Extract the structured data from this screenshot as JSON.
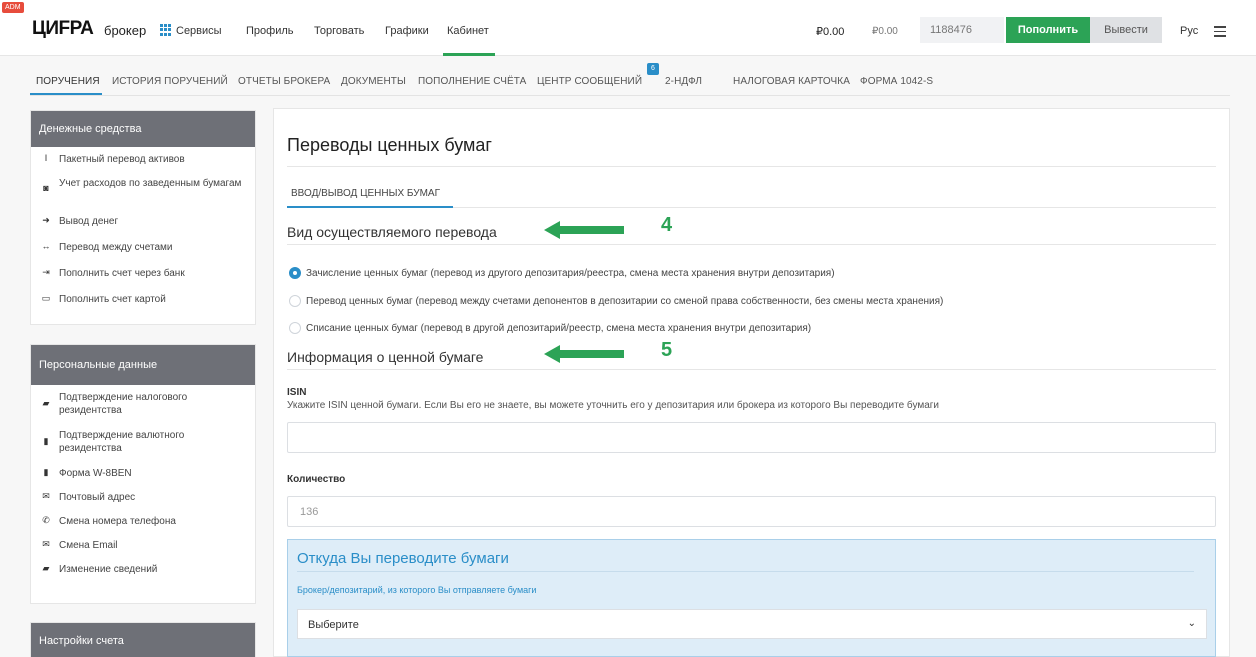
{
  "topbar": {
    "adm_badge": "ADM",
    "logo": "ЦИFРА",
    "logo_sub": "брокер",
    "nav": [
      "Сервисы",
      "Профиль",
      "Торговать",
      "Графики",
      "Кабинет"
    ],
    "balance_rub": "₽0.00",
    "balance_rub2": "₽0.00",
    "account": "1188476",
    "topup_label": "Пополнить",
    "withdraw_label": "Вывести",
    "lang": "Рус",
    "accent_color": "#2ca356"
  },
  "subnav": {
    "items": [
      "ПОРУЧЕНИЯ",
      "ИСТОРИЯ ПОРУЧЕНИЙ",
      "ОТЧЕТЫ БРОКЕРА",
      "ДОКУМЕНТЫ",
      "ПОПОЛНЕНИЕ СЧЁТА",
      "ЦЕНТР СООБЩЕНИЙ",
      "2-НДФЛ",
      "НАЛОГОВАЯ КАРТОЧКА",
      "ФОРМА 1042-S"
    ],
    "messages_badge": "6",
    "active_index": 0
  },
  "sidebar": {
    "money": {
      "title": "Денежные средства",
      "items": [
        {
          "icon": "cursor-icon",
          "label": "Пакетный перевод активов"
        },
        {
          "icon": "money-icon",
          "label": "Учет расходов по заведенным бумагам"
        },
        {
          "icon": "withdraw-icon",
          "label": "Вывод денег"
        },
        {
          "icon": "transfer-icon",
          "label": "Перевод между счетами"
        },
        {
          "icon": "bank-icon",
          "label": "Пополнить счет через банк"
        },
        {
          "icon": "card-icon",
          "label": "Пополнить счет картой"
        }
      ]
    },
    "personal": {
      "title": "Персональные данные",
      "items": [
        {
          "icon": "folder-icon",
          "label": "Подтверждение налогового резидентства"
        },
        {
          "icon": "file-icon",
          "label": "Подтверждение валютного резидентства"
        },
        {
          "icon": "document-icon",
          "label": "Форма W-8BEN"
        },
        {
          "icon": "envelope-icon",
          "label": "Почтовый адрес"
        },
        {
          "icon": "phone-icon",
          "label": "Смена номера телефона"
        },
        {
          "icon": "envelope-icon",
          "label": "Смена Email"
        },
        {
          "icon": "folder-open-icon",
          "label": "Изменение сведений"
        }
      ]
    },
    "settings": {
      "title": "Настройки счета"
    }
  },
  "main": {
    "title": "Переводы ценных бумаг",
    "tab": "ВВОД/ВЫВОД ЦЕННЫХ БУМАГ",
    "section_type": "Вид осуществляемого перевода",
    "annotation_4": "4",
    "annotation_5": "5",
    "radios": [
      {
        "label": "Зачисление ценных бумаг (перевод из другого депозитария/реестра, смена места хранения внутри депозитария)",
        "checked": true
      },
      {
        "label": "Перевод ценных бумаг (перевод между счетами депонентов в депозитарии со сменой права собственности, без смены места хранения)",
        "checked": false
      },
      {
        "label": "Списание ценных бумаг (перевод в другой депозитарий/реестр, смена места хранения внутри депозитария)",
        "checked": false
      }
    ],
    "section_info": "Информация о ценной бумаге",
    "isin_label": "ISIN",
    "isin_hint": "Укажите ISIN ценной бумаги. Если Вы его не знаете, вы можете уточнить его у депозитария или брокера из которого Вы переводите бумаги",
    "isin_value": "",
    "qty_label": "Количество",
    "qty_placeholder": "136",
    "from": {
      "title": "Откуда Вы переводите бумаги",
      "label": "Брокер/депозитарий, из которого Вы отправляете бумаги",
      "select_value": "Выберите"
    }
  }
}
